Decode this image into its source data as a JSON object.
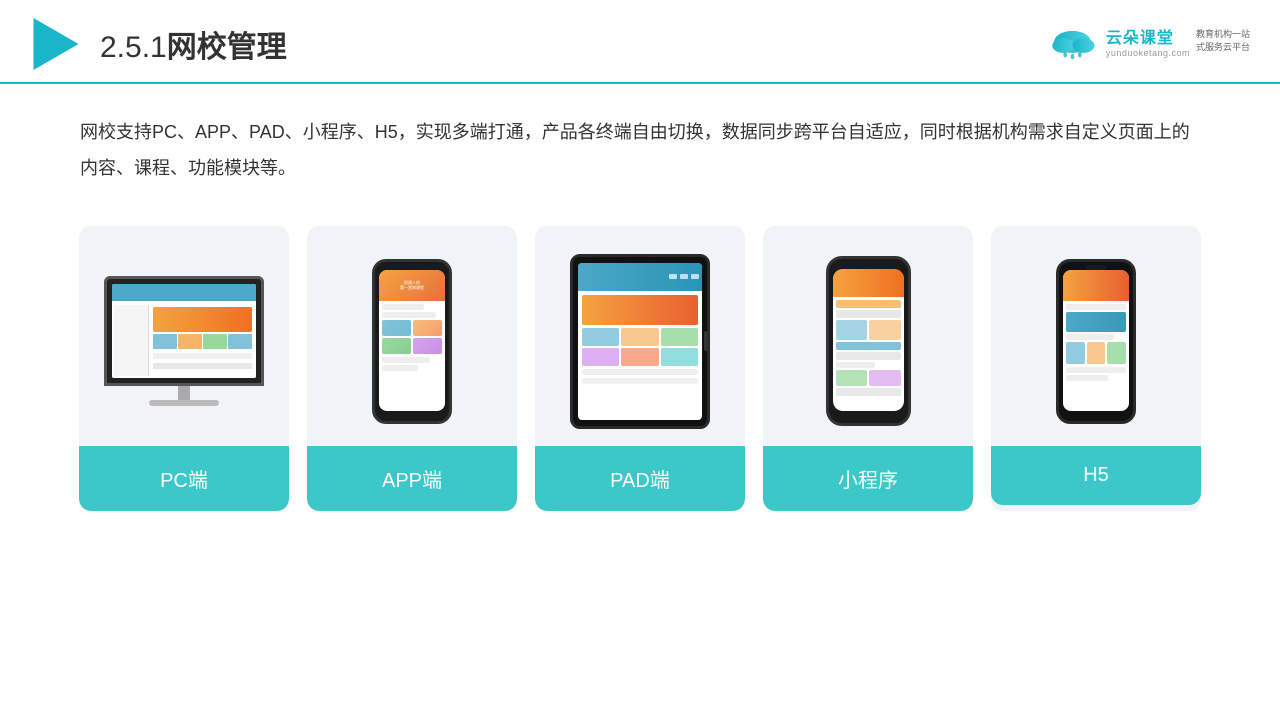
{
  "header": {
    "title": "2.5.1网校管理",
    "title_number": "2.5.1",
    "title_text": "网校管理"
  },
  "brand": {
    "name": "云朵课堂",
    "url": "yunduoketang.com",
    "tagline": "教育机构一站\n式服务云平台"
  },
  "description": {
    "text": "网校支持PC、APP、PAD、小程序、H5，实现多端打通，产品各终端自由切换，数据同步跨平台自适应，同时根据机构需求自定义页面上的内容、课程、功能模块等。"
  },
  "cards": [
    {
      "id": "pc",
      "label": "PC端"
    },
    {
      "id": "app",
      "label": "APP端"
    },
    {
      "id": "pad",
      "label": "PAD端"
    },
    {
      "id": "miniprogram",
      "label": "小程序"
    },
    {
      "id": "h5",
      "label": "H5"
    }
  ],
  "colors": {
    "accent": "#3cc8c8",
    "header_line": "#1ab5c8",
    "brand_color": "#1ab5c8"
  }
}
